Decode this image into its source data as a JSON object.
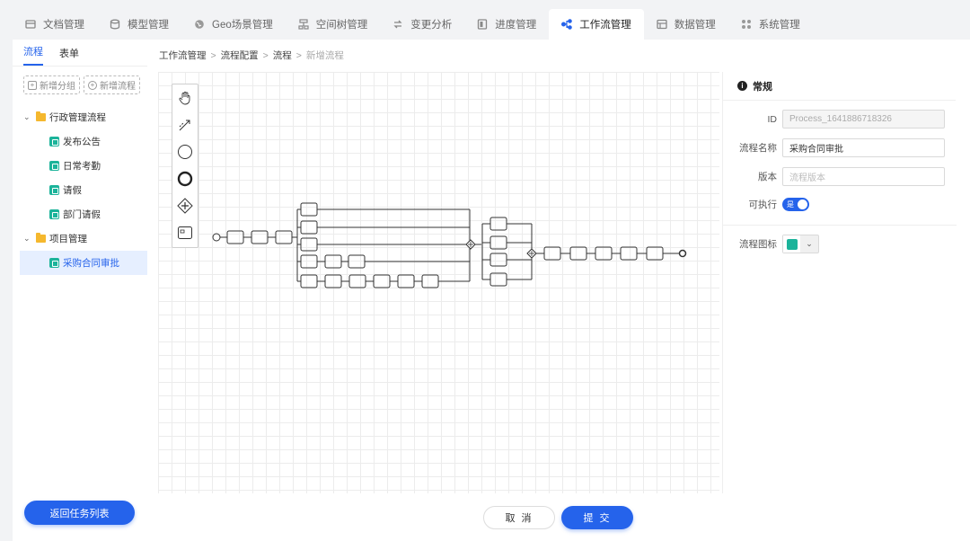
{
  "nav": [
    {
      "label": "文档管理",
      "icon": "document-icon"
    },
    {
      "label": "模型管理",
      "icon": "database-icon"
    },
    {
      "label": "Geo场景管理",
      "icon": "globe-icon"
    },
    {
      "label": "空间树管理",
      "icon": "tree-icon"
    },
    {
      "label": "变更分析",
      "icon": "change-icon"
    },
    {
      "label": "进度管理",
      "icon": "progress-icon"
    },
    {
      "label": "工作流管理",
      "icon": "workflow-icon",
      "active": true
    },
    {
      "label": "数据管理",
      "icon": "data-icon"
    },
    {
      "label": "系统管理",
      "icon": "settings-icon"
    }
  ],
  "sidebar": {
    "tabs": [
      "流程",
      "表单"
    ],
    "active_tab": "流程",
    "add_group": "新增分组",
    "add_flow": "新增流程",
    "groups": [
      {
        "label": "行政管理流程",
        "items": [
          "发布公告",
          "日常考勤",
          "请假",
          "部门请假"
        ]
      },
      {
        "label": "项目管理",
        "items": [
          "采购合同审批"
        ]
      }
    ],
    "selected_item": "采购合同审批",
    "back_button": "返回任务列表"
  },
  "breadcrumb": {
    "items": [
      "工作流管理",
      "流程配置",
      "流程"
    ],
    "current": "新增流程",
    "separator": ">"
  },
  "toolbar": {
    "tools": [
      "hand-tool-icon",
      "connect-tool-icon",
      "start-event-icon",
      "end-event-icon",
      "gateway-icon",
      "task-icon"
    ]
  },
  "props": {
    "title": "常规",
    "id_label": "ID",
    "id_value": "Process_1641886718326",
    "name_label": "流程名称",
    "name_value": "采购合同审批",
    "version_label": "版本",
    "version_placeholder": "流程版本",
    "executable_label": "可执行",
    "executable_value": "是",
    "icon_label": "流程图标",
    "icon_color": "#1bb39a"
  },
  "footer": {
    "cancel": "取 消",
    "submit": "提 交"
  },
  "colors": {
    "accent": "#2563eb",
    "folder": "#f5b82e",
    "leaf_icon": "#1bb39a"
  }
}
